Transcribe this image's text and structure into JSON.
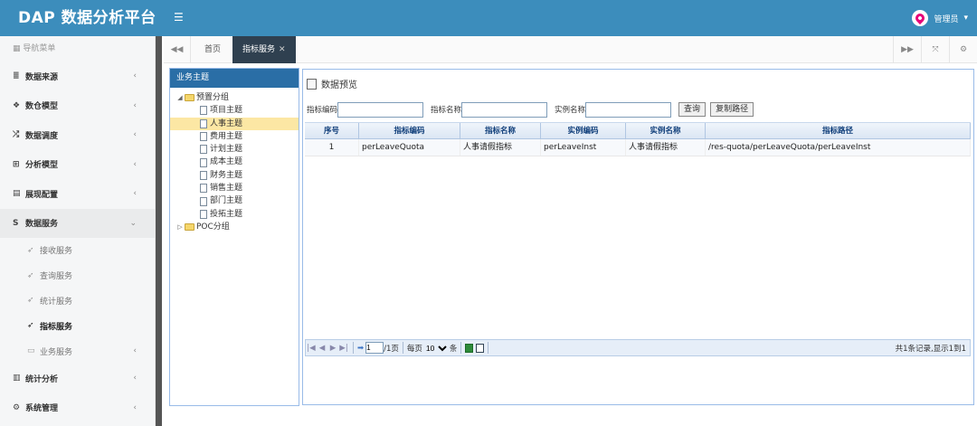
{
  "app": {
    "title": "DAP 数据分析平台",
    "user": "管理员"
  },
  "sidebar": {
    "header": "导航菜单",
    "menus": [
      {
        "label": "数据来源",
        "icon": "database-icon"
      },
      {
        "label": "数仓模型",
        "icon": "cubes-icon"
      },
      {
        "label": "数据调度",
        "icon": "random-icon"
      },
      {
        "label": "分析模型",
        "icon": "sitemap-icon"
      },
      {
        "label": "展现配置",
        "icon": "film-icon"
      },
      {
        "label": "数据服务",
        "icon": "s-icon"
      }
    ],
    "sub_items": [
      {
        "label": "接收服务",
        "icon": "leaf-icon"
      },
      {
        "label": "查询服务",
        "icon": "leaf-icon"
      },
      {
        "label": "统计服务",
        "icon": "leaf-icon"
      },
      {
        "label": "指标服务",
        "icon": "leaf-icon"
      },
      {
        "label": "业务服务",
        "icon": "folder-icon"
      }
    ],
    "menus_after": [
      {
        "label": "统计分析",
        "icon": "bar-chart-icon"
      },
      {
        "label": "系统管理",
        "icon": "gear-icon"
      }
    ]
  },
  "tabs": {
    "home": "首页",
    "active": "指标服务"
  },
  "tree": {
    "title": "业务主题",
    "root": "预置分组",
    "children": [
      "项目主题",
      "人事主题",
      "费用主题",
      "计划主题",
      "成本主题",
      "财务主题",
      "销售主题",
      "部门主题",
      "投拓主题"
    ],
    "selected": "人事主题",
    "other_root": "POC分组"
  },
  "panel": {
    "title": "数据预览",
    "search": {
      "code_label": "指标编码",
      "name_label": "指标名称",
      "inst_label": "实例名称",
      "query_btn": "查询",
      "copy_btn": "复制路径"
    },
    "columns": [
      "序号",
      "指标编码",
      "指标名称",
      "实例编码",
      "实例名称",
      "指标路径"
    ],
    "rows": [
      [
        "1",
        "perLeaveQuota",
        "人事请假指标",
        "perLeaveInst",
        "人事请假指标",
        "/res-quota/perLeaveQuota/perLeaveInst"
      ]
    ],
    "pager": {
      "page": "1",
      "total_pages": "/1页",
      "per_page_label": "每页",
      "per_page": "10",
      "unit": "条",
      "info": "共1条记录,显示1到1"
    }
  }
}
